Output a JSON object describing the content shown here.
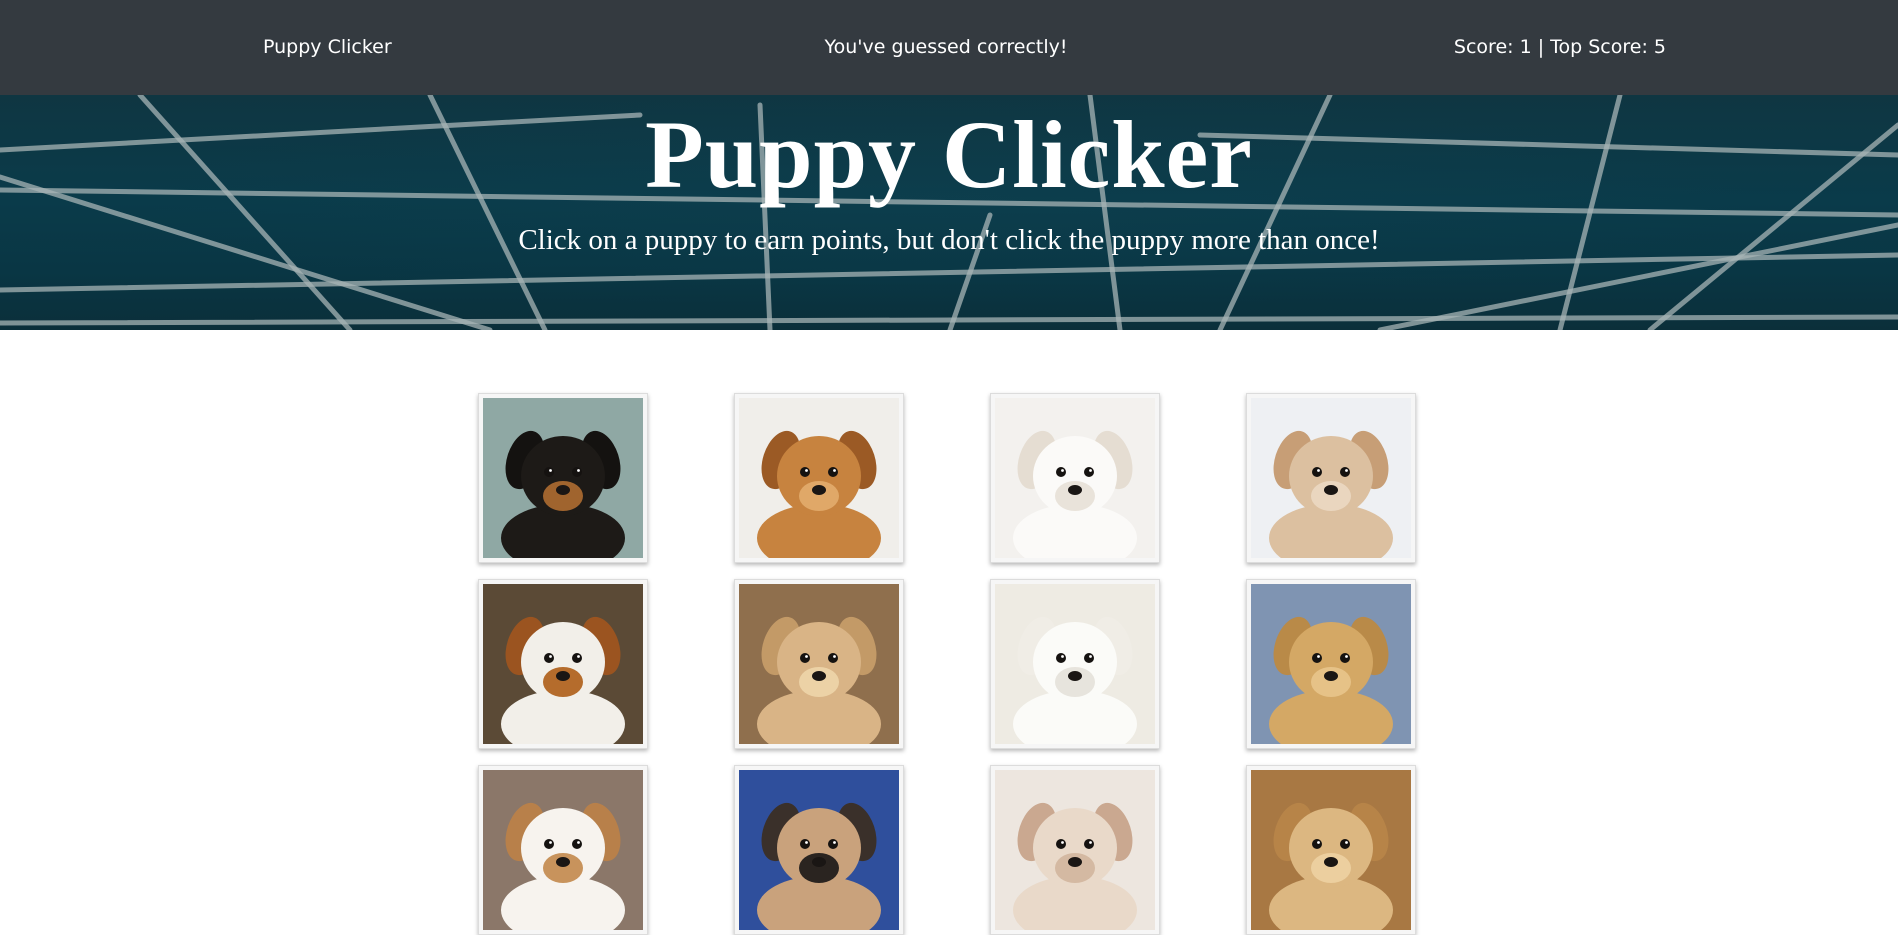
{
  "navbar": {
    "brand": "Puppy Clicker",
    "message": "You've guessed correctly!",
    "score_text": "Score: 1 | Top Score: 5"
  },
  "hero": {
    "title": "Puppy Clicker",
    "subtitle": "Click on a puppy to earn points, but don't click the puppy more than once!"
  },
  "colors": {
    "navbar_bg": "#343a40",
    "hero_bg": "#0a3b4a",
    "grid_lines": "#9fb3b8",
    "card_bg": "#f6f6f6"
  },
  "cards": [
    {
      "name": "puppy-rottweiler",
      "bg": "#8fa8a4",
      "fur": "#1d1a17",
      "accent": "#a0642e",
      "ear": "#141210"
    },
    {
      "name": "puppy-sleeping-tan",
      "bg": "#f0eeea",
      "fur": "#c7833f",
      "accent": "#e0a868",
      "ear": "#9b5a25"
    },
    {
      "name": "puppy-white-maltese",
      "bg": "#f3f1ee",
      "fur": "#fbfaf8",
      "accent": "#e9e3da",
      "ear": "#e5ddd2"
    },
    {
      "name": "puppy-cream-maltipoo",
      "bg": "#eef0f3",
      "fur": "#dcc0a0",
      "accent": "#ead6bf",
      "ear": "#c79e76"
    },
    {
      "name": "puppy-white-brown-lying",
      "bg": "#5b4a36",
      "fur": "#f2efe9",
      "accent": "#b56c2c",
      "ear": "#9b5420"
    },
    {
      "name": "puppy-golden-fluffy",
      "bg": "#8f6f4d",
      "fur": "#d9b486",
      "accent": "#ecd2a6",
      "ear": "#c39a67"
    },
    {
      "name": "puppy-white-pomeranian",
      "bg": "#eeebe3",
      "fur": "#fbfbf8",
      "accent": "#e7e4dd",
      "ear": "#f0ede6"
    },
    {
      "name": "puppy-golden-sleeping",
      "bg": "#7f94b2",
      "fur": "#d4a865",
      "accent": "#e6c287",
      "ear": "#b98a48"
    },
    {
      "name": "puppy-cavalier",
      "bg": "#8b7769",
      "fur": "#f7f3ee",
      "accent": "#c8935c",
      "ear": "#b8804a"
    },
    {
      "name": "puppy-pug",
      "bg": "#2f4f9c",
      "fur": "#c9a27c",
      "accent": "#2a2420",
      "ear": "#3a302a"
    },
    {
      "name": "puppy-french-bulldog",
      "bg": "#ede6df",
      "fur": "#e9d9c9",
      "accent": "#d4b9a2",
      "ear": "#caa890"
    },
    {
      "name": "puppy-apricot-poodle",
      "bg": "#a87843",
      "fur": "#dcb781",
      "accent": "#eccf9f",
      "ear": "#b78448"
    }
  ]
}
